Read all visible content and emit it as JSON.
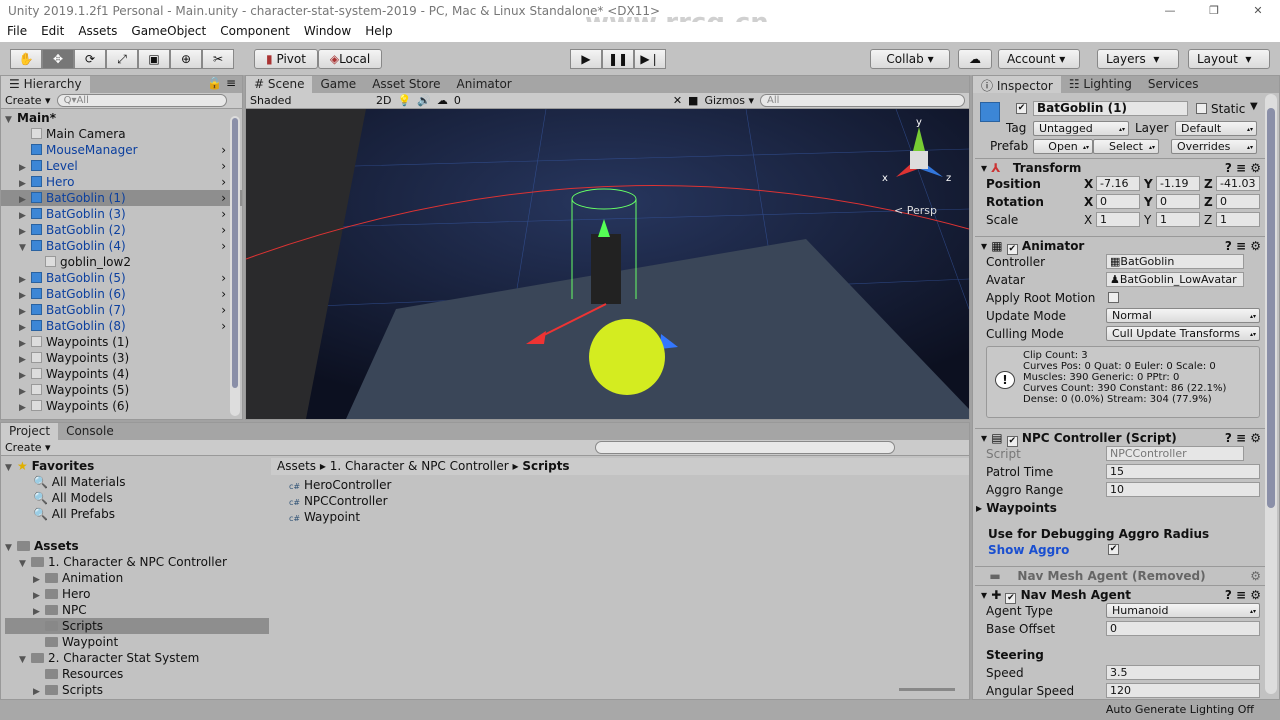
{
  "title": "Unity 2019.1.2f1 Personal - Main.unity - character-stat-system-2019 - PC, Mac & Linux Standalone* <DX11>",
  "watermark": "www.rrcg.cn",
  "menu": [
    "File",
    "Edit",
    "Assets",
    "GameObject",
    "Component",
    "Window",
    "Help"
  ],
  "toolbar": {
    "pivot": "Pivot",
    "local": "Local",
    "collab": "Collab ▾",
    "account": "Account",
    "layers": "Layers",
    "layout": "Layout"
  },
  "hierarchy": {
    "tab": "Hierarchy",
    "create": "Create ▾",
    "search_placeholder": "Q▾All",
    "items": [
      {
        "label": "Main*",
        "depth": 0,
        "arrow": "▼",
        "type": "scene"
      },
      {
        "label": "Main Camera",
        "depth": 1,
        "arrow": "",
        "type": "gray"
      },
      {
        "label": "MouseManager",
        "depth": 1,
        "arrow": "",
        "type": "prefab"
      },
      {
        "label": "Level",
        "depth": 1,
        "arrow": "▶",
        "type": "prefab"
      },
      {
        "label": "Hero",
        "depth": 1,
        "arrow": "▶",
        "type": "prefab"
      },
      {
        "label": "BatGoblin (1)",
        "depth": 1,
        "arrow": "▶",
        "type": "prefab",
        "selected": true
      },
      {
        "label": "BatGoblin (3)",
        "depth": 1,
        "arrow": "▶",
        "type": "prefab"
      },
      {
        "label": "BatGoblin (2)",
        "depth": 1,
        "arrow": "▶",
        "type": "prefab"
      },
      {
        "label": "BatGoblin (4)",
        "depth": 1,
        "arrow": "▼",
        "type": "prefab"
      },
      {
        "label": "goblin_low2",
        "depth": 2,
        "arrow": "",
        "type": "gray"
      },
      {
        "label": "BatGoblin (5)",
        "depth": 1,
        "arrow": "▶",
        "type": "prefab"
      },
      {
        "label": "BatGoblin (6)",
        "depth": 1,
        "arrow": "▶",
        "type": "prefab"
      },
      {
        "label": "BatGoblin (7)",
        "depth": 1,
        "arrow": "▶",
        "type": "prefab"
      },
      {
        "label": "BatGoblin (8)",
        "depth": 1,
        "arrow": "▶",
        "type": "prefab"
      },
      {
        "label": "Waypoints (1)",
        "depth": 1,
        "arrow": "▶",
        "type": "gray"
      },
      {
        "label": "Waypoints (3)",
        "depth": 1,
        "arrow": "▶",
        "type": "gray"
      },
      {
        "label": "Waypoints (4)",
        "depth": 1,
        "arrow": "▶",
        "type": "gray"
      },
      {
        "label": "Waypoints (5)",
        "depth": 1,
        "arrow": "▶",
        "type": "gray"
      },
      {
        "label": "Waypoints (6)",
        "depth": 1,
        "arrow": "▶",
        "type": "gray"
      }
    ]
  },
  "scene": {
    "tabs": [
      "# Scene",
      "Game",
      "Asset Store",
      "Animator"
    ],
    "shading": "Shaded",
    "mode2d": "2D",
    "hidden_count": "0",
    "gizmos": "Gizmos ▾",
    "search_placeholder": "All",
    "persp": "< Persp",
    "axis": {
      "x": "x",
      "y": "y",
      "z": "z"
    }
  },
  "inspector": {
    "tabs": [
      "Inspector",
      "Lighting",
      "Services"
    ],
    "object_name": "BatGoblin (1)",
    "static": "Static",
    "tag_label": "Tag",
    "tag": "Untagged",
    "layer_label": "Layer",
    "layer": "Default",
    "prefab_label": "Prefab",
    "open": "Open",
    "select": "Select",
    "overrides": "Overrides",
    "transform": {
      "title": "Transform",
      "position_label": "Position",
      "rotation_label": "Rotation",
      "scale_label": "Scale",
      "position": [
        "-7.16",
        "-1.19",
        "-41.03"
      ],
      "rotation": [
        "0",
        "0",
        "0"
      ],
      "scale": [
        "1",
        "1",
        "1"
      ],
      "axes": [
        "X",
        "Y",
        "Z"
      ]
    },
    "animator": {
      "title": "Animator",
      "controller_label": "Controller",
      "controller": "BatGoblin",
      "avatar_label": "Avatar",
      "avatar": "BatGoblin_LowAvatar",
      "root_motion_label": "Apply Root Motion",
      "update_label": "Update Mode",
      "update": "Normal",
      "culling_label": "Culling Mode",
      "culling": "Cull Update Transforms",
      "info": [
        "Clip Count: 3",
        "Curves Pos: 0 Quat: 0 Euler: 0 Scale: 0",
        "Muscles: 390 Generic: 0 PPtr: 0",
        "Curves Count: 390 Constant: 86 (22.1%)",
        "Dense: 0 (0.0%) Stream: 304 (77.9%)"
      ]
    },
    "npc": {
      "title": "NPC Controller (Script)",
      "script_label": "Script",
      "script": "NPCController",
      "patrol_label": "Patrol Time",
      "patrol": "15",
      "aggro_label": "Aggro Range",
      "aggro": "10",
      "waypoints_label": "Waypoints",
      "debug_header": "Use for Debugging Aggro Radius",
      "show_aggro_label": "Show Aggro"
    },
    "nav_removed": "Nav Mesh Agent (Removed)",
    "nav": {
      "title": "Nav Mesh Agent",
      "agent_type_label": "Agent Type",
      "agent_type": "Humanoid",
      "base_offset_label": "Base Offset",
      "base_offset": "0",
      "steering": "Steering",
      "speed_label": "Speed",
      "speed": "3.5",
      "angular_label": "Angular Speed",
      "angular": "120"
    }
  },
  "project": {
    "tabs": [
      "Project",
      "Console"
    ],
    "create": "Create ▾",
    "favorites": {
      "label": "Favorites",
      "items": [
        "All Materials",
        "All Models",
        "All Prefabs"
      ]
    },
    "assets": {
      "label": "Assets",
      "items": [
        {
          "label": "1. Character & NPC Controller",
          "depth": 1,
          "arrow": "▼"
        },
        {
          "label": "Animation",
          "depth": 2,
          "arrow": "▶"
        },
        {
          "label": "Hero",
          "depth": 2,
          "arrow": "▶"
        },
        {
          "label": "NPC",
          "depth": 2,
          "arrow": "▶"
        },
        {
          "label": "Scripts",
          "depth": 2,
          "arrow": "",
          "selected": true
        },
        {
          "label": "Waypoint",
          "depth": 2,
          "arrow": ""
        },
        {
          "label": "2. Character Stat System",
          "depth": 1,
          "arrow": "▼"
        },
        {
          "label": "Resources",
          "depth": 2,
          "arrow": ""
        },
        {
          "label": "Scripts",
          "depth": 2,
          "arrow": "▶"
        }
      ]
    },
    "breadcrumb": [
      "Assets",
      "1. Character & NPC Controller",
      "Scripts"
    ],
    "files": [
      "HeroController",
      "NPCController",
      "Waypoint"
    ]
  },
  "status": "Auto Generate Lighting Off",
  "colors": {
    "accent_selection": "#8e8e8e",
    "prefab_text": "#0b3f9e",
    "panel": "#c2c2c2"
  }
}
